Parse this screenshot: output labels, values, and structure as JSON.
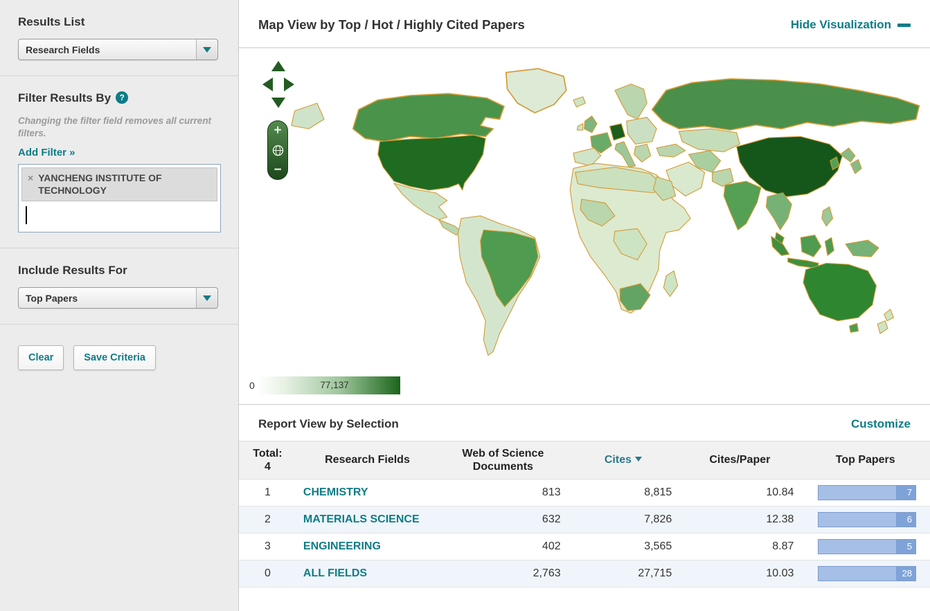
{
  "icons": {
    "close": "×",
    "plus": "+",
    "minus": "−",
    "help": "?"
  },
  "colors": {
    "accent_teal": "#0e7c86",
    "map_dark_green": "#15571b",
    "map_border_orange": "#d59a33",
    "bar_blue": "#a6bfe6",
    "sidebar_bg": "#ececec"
  },
  "sidebar": {
    "results_list_title": "Results List",
    "results_dropdown_value": "Research Fields",
    "filter_title": "Filter Results By",
    "filter_note": "Changing the filter field removes all current filters.",
    "add_filter_label": "Add Filter »",
    "filter_tag": "YANCHENG INSTITUTE OF TECHNOLOGY",
    "include_title": "Include Results For",
    "include_dropdown_value": "Top Papers",
    "clear_button": "Clear",
    "save_button": "Save Criteria"
  },
  "map_panel": {
    "title": "Map View by Top / Hot / Highly Cited Papers",
    "hide_link": "Hide Visualization",
    "legend_min": "0",
    "legend_max": "77,137"
  },
  "report": {
    "title": "Report View by Selection",
    "customize_link": "Customize",
    "total_label": "Total:",
    "total_value": "4",
    "columns": {
      "field": "Research Fields",
      "docs": "Web of Science Documents",
      "cites": "Cites",
      "cites_per_paper": "Cites/Paper",
      "top_papers": "Top Papers"
    },
    "rows": [
      {
        "rank": "1",
        "field": "CHEMISTRY",
        "docs": "813",
        "cites": "8,815",
        "cpp": "10.84",
        "top": "7"
      },
      {
        "rank": "2",
        "field": "MATERIALS SCIENCE",
        "docs": "632",
        "cites": "7,826",
        "cpp": "12.38",
        "top": "6"
      },
      {
        "rank": "3",
        "field": "ENGINEERING",
        "docs": "402",
        "cites": "3,565",
        "cpp": "8.87",
        "top": "5"
      },
      {
        "rank": "0",
        "field": "ALL FIELDS",
        "docs": "2,763",
        "cites": "27,715",
        "cpp": "10.03",
        "top": "28"
      }
    ]
  }
}
